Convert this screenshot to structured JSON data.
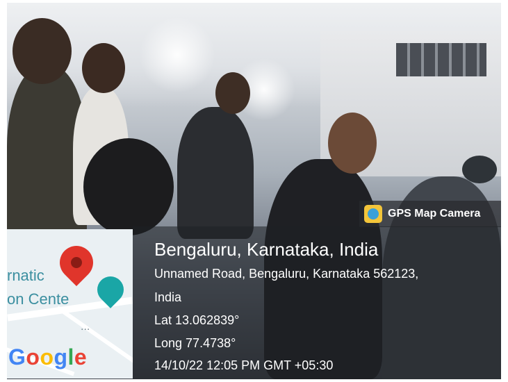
{
  "photo": {
    "description_colors": {
      "overlay": "#1e2024",
      "pin": "#e0352b",
      "poi": "#1aa6a6"
    }
  },
  "app_badge": {
    "label": "GPS Map Camera",
    "icon": "gps-map-camera-icon"
  },
  "location": {
    "title": "Bengaluru, Karnataka, India",
    "address_line1": "Unnamed Road, Bengaluru, Karnataka 562123,",
    "address_line2": "India",
    "lat": "Lat 13.062839°",
    "long": "Long 77.4738°",
    "timestamp": "14/10/22 12:05 PM GMT +05:30"
  },
  "map": {
    "label_line1": "rnatic",
    "label_line2": "on Cent",
    "label_suffix": "e",
    "brand": "Google",
    "ellipsis": "...",
    "pin_icon": "map-pin-icon",
    "poi_icon": "monument-icon"
  }
}
